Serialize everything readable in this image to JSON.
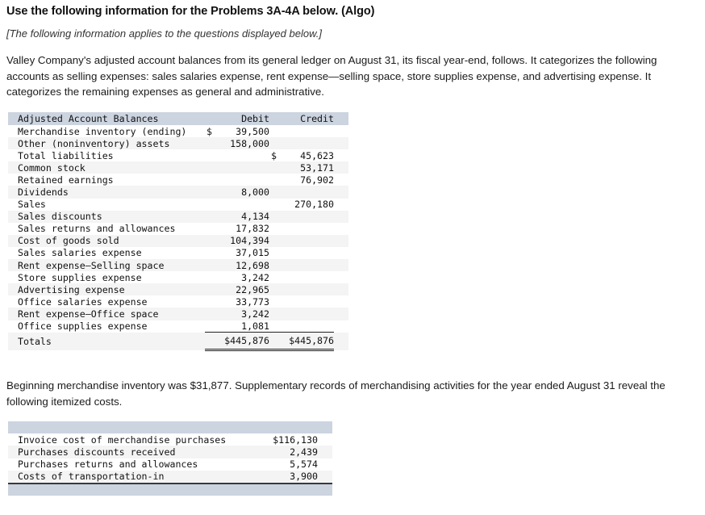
{
  "header": {
    "title": "Use the following information for the Problems 3A-4A below. (Algo)",
    "note": "[The following information applies to the questions displayed below.]"
  },
  "intro_paragraph": "Valley Company's adjusted account balances from its general ledger on August 31, its fiscal year-end, follows. It categorizes the following accounts as selling expenses: sales salaries expense, rent expense—selling space, store supplies expense, and advertising expense. It categorizes the remaining expenses as general and administrative.",
  "second_paragraph": "Beginning merchandise inventory was $31,877. Supplementary records of merchandising activities for the year ended August 31 reveal the following itemized costs.",
  "balances_table": {
    "columns": {
      "label": "Adjusted Account Balances",
      "debit": "Debit",
      "credit": "Credit"
    },
    "rows": [
      {
        "label": "Merchandise inventory (ending)",
        "debit_symbol": "$",
        "debit": "39,500",
        "credit_symbol": "",
        "credit": ""
      },
      {
        "label": "Other (noninventory) assets",
        "debit_symbol": "",
        "debit": "158,000",
        "credit_symbol": "",
        "credit": ""
      },
      {
        "label": "Total liabilities",
        "debit_symbol": "",
        "debit": "",
        "credit_symbol": "$",
        "credit": "45,623"
      },
      {
        "label": "Common stock",
        "debit_symbol": "",
        "debit": "",
        "credit_symbol": "",
        "credit": "53,171"
      },
      {
        "label": "Retained earnings",
        "debit_symbol": "",
        "debit": "",
        "credit_symbol": "",
        "credit": "76,902"
      },
      {
        "label": "Dividends",
        "debit_symbol": "",
        "debit": "8,000",
        "credit_symbol": "",
        "credit": ""
      },
      {
        "label": "Sales",
        "debit_symbol": "",
        "debit": "",
        "credit_symbol": "",
        "credit": "270,180"
      },
      {
        "label": "Sales discounts",
        "debit_symbol": "",
        "debit": "4,134",
        "credit_symbol": "",
        "credit": ""
      },
      {
        "label": "Sales returns and allowances",
        "debit_symbol": "",
        "debit": "17,832",
        "credit_symbol": "",
        "credit": ""
      },
      {
        "label": "Cost of goods sold",
        "debit_symbol": "",
        "debit": "104,394",
        "credit_symbol": "",
        "credit": ""
      },
      {
        "label": "Sales salaries expense",
        "debit_symbol": "",
        "debit": "37,015",
        "credit_symbol": "",
        "credit": ""
      },
      {
        "label": "Rent expense—Selling space",
        "debit_symbol": "",
        "debit": "12,698",
        "credit_symbol": "",
        "credit": ""
      },
      {
        "label": "Store supplies expense",
        "debit_symbol": "",
        "debit": "3,242",
        "credit_symbol": "",
        "credit": ""
      },
      {
        "label": "Advertising expense",
        "debit_symbol": "",
        "debit": "22,965",
        "credit_symbol": "",
        "credit": ""
      },
      {
        "label": "Office salaries expense",
        "debit_symbol": "",
        "debit": "33,773",
        "credit_symbol": "",
        "credit": ""
      },
      {
        "label": "Rent expense—Office space",
        "debit_symbol": "",
        "debit": "3,242",
        "credit_symbol": "",
        "credit": ""
      },
      {
        "label": "Office supplies expense",
        "debit_symbol": "",
        "debit": "1,081",
        "credit_symbol": "",
        "credit": ""
      }
    ],
    "totals": {
      "label": "Totals",
      "debit": "$445,876",
      "credit": "$445,876"
    }
  },
  "costs_table": {
    "header_label": "",
    "rows": [
      {
        "label": "Invoice cost of merchandise purchases",
        "value": "$116,130"
      },
      {
        "label": "Purchases discounts received",
        "value": "2,439"
      },
      {
        "label": "Purchases returns and allowances",
        "value": "5,574"
      },
      {
        "label": "Costs of transportation-in",
        "value": "3,900"
      }
    ]
  },
  "colors": {
    "table_header": "#ccd4e0",
    "stripe": "#f4f4f4",
    "text": "#111111"
  }
}
